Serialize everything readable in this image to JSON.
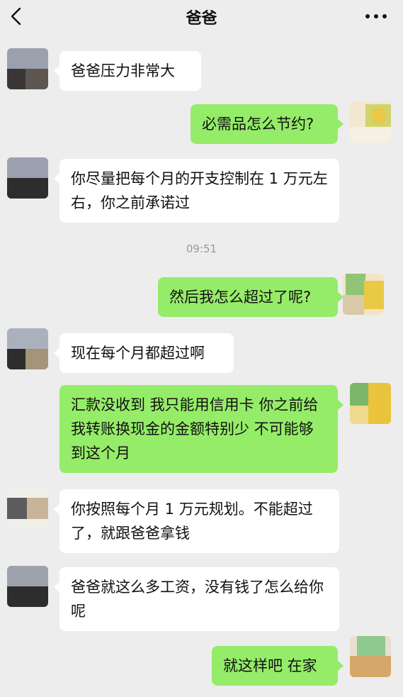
{
  "header": {
    "title": "爸爸",
    "back_icon": "chevron-left-icon",
    "more_icon": "ellipsis-icon"
  },
  "timestamp": "09:51",
  "messages": [
    {
      "side": "left",
      "text": "爸爸压力非常大"
    },
    {
      "side": "right",
      "text": "必需品怎么节约?"
    },
    {
      "side": "left",
      "text": "你尽量把每个月的开支控制在 1 万元左右，你之前承诺过"
    },
    {
      "side": "right",
      "text": "然后我怎么超过了呢?"
    },
    {
      "side": "left",
      "text": "现在每个月都超过啊"
    },
    {
      "side": "right",
      "text": "汇款没收到 我只能用信用卡 你之前给我转账换现金的金额特别少 不可能够到这个月"
    },
    {
      "side": "left",
      "text": "你按照每个月 1 万元规划。不能超过了，就跟爸爸拿钱"
    },
    {
      "side": "left",
      "text": "爸爸就这么多工资，没有钱了怎么给你呢"
    },
    {
      "side": "right",
      "text": "就这样吧 在家"
    }
  ],
  "colors": {
    "background": "#ededed",
    "bubble_self": "#95ec69",
    "bubble_other": "#ffffff"
  }
}
